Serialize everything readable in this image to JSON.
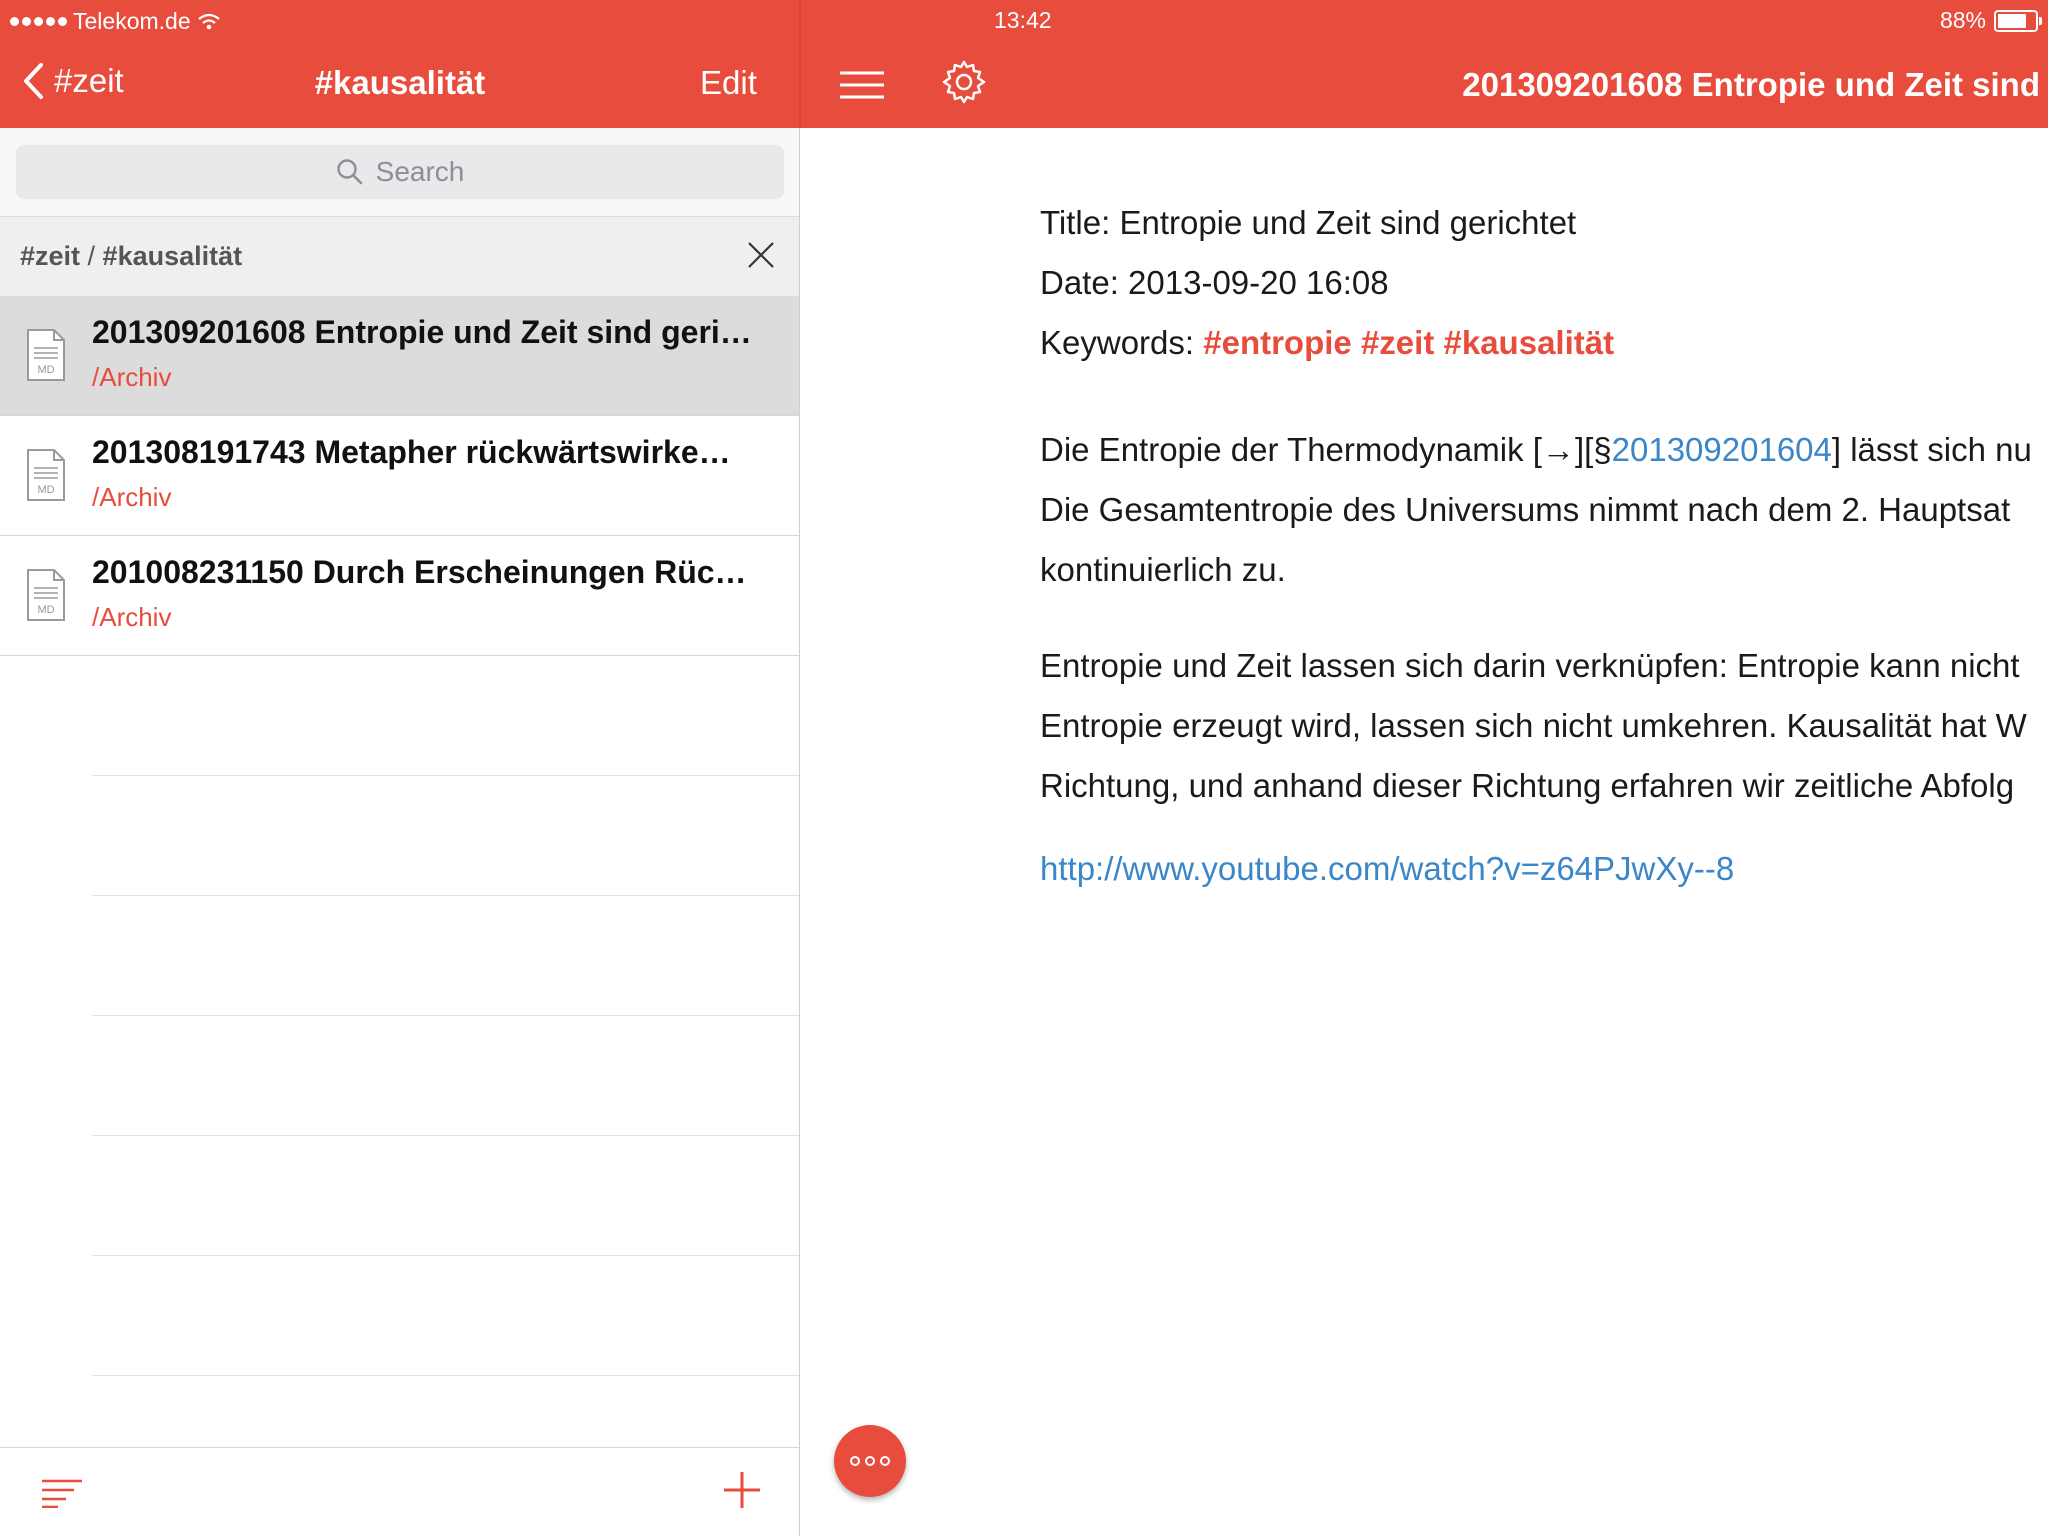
{
  "status_bar": {
    "carrier": "Telekom.de",
    "time": "13:42",
    "battery": "88%",
    "battery_level": 0.88
  },
  "nav": {
    "back_label": "#zeit",
    "title": "#kausalität",
    "edit_label": "Edit",
    "document_title": "201309201608 Entropie und Zeit sind"
  },
  "search": {
    "placeholder": "Search"
  },
  "filter": {
    "path_a": "#zeit",
    "sep": " / ",
    "path_b": "#kausalität"
  },
  "notes": [
    {
      "title": "201309201608 Entropie und Zeit sind geri…",
      "path": "/Archiv",
      "icon_label": "MD",
      "selected": true
    },
    {
      "title": "201308191743 Metapher rückwärtswirke…",
      "path": "/Archiv",
      "icon_label": "MD",
      "selected": false
    },
    {
      "title": "201008231150 Durch Erscheinungen Rüc…",
      "path": "/Archiv",
      "icon_label": "MD",
      "selected": false
    }
  ],
  "document": {
    "title_line": "Title: Entropie und Zeit sind gerichtet",
    "date_line": "Date: 2013-09-20 16:08",
    "keywords_label": "Keywords: ",
    "keywords": [
      "#entropie",
      "#zeit",
      "#kausalität"
    ],
    "para1_line1_a": "Die Entropie der Thermodynamik [→][§",
    "para1_link": "201309201604",
    "para1_line1_b": "] lässt sich nu",
    "para1_line2": "Die Gesamtentropie des Universums nimmt nach dem 2. Hauptsat",
    "para1_line3": "kontinuierlich zu.",
    "para2_line1": "Entropie und Zeit lassen sich darin verknüpfen: Entropie kann nicht",
    "para2_line2": "Entropie erzeugt wird, lassen sich nicht umkehren. Kausalität hat W",
    "para2_line3": "Richtung, und anhand dieser Richtung erfahren wir zeitliche Abfolg",
    "url": "http://www.youtube.com/watch?v=z64PJwXy--8"
  },
  "icons": {
    "back": "chevron-left-icon",
    "menu": "hamburger-icon",
    "settings": "gear-icon",
    "search": "magnifier-icon",
    "close": "close-icon",
    "note": "markdown-file-icon",
    "sort": "sort-icon",
    "add": "plus-icon",
    "more": "more-icon"
  },
  "colors": {
    "accent": "#e74c3c",
    "link": "#3a86c8",
    "selected_row": "#dcdcdc"
  }
}
